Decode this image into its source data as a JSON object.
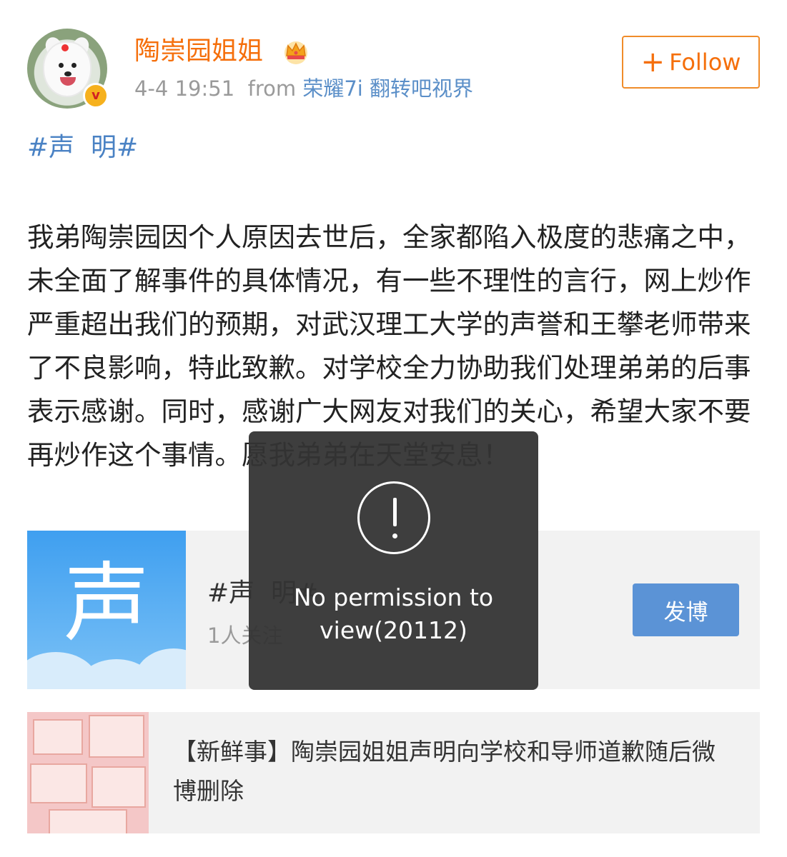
{
  "post": {
    "username": "陶崇园姐姐",
    "verified_badge": "v",
    "time": "4-4 19:51",
    "from_label": "from",
    "source": "荣耀7i 翻转吧视界",
    "follow_label": "Follow",
    "hashtag": "#声  明#",
    "body": "我弟陶崇园因个人原因去世后，全家都陷入极度的悲痛之中，未全面了解事件的具体情况，有一些不理性的言行，网上炒作严重超出我们的预期，对武汉理工大学的声誉和王攀老师带来了不良影响，特此致歉。对学校全力协助我们处理弟弟的后事表示感谢。同时，感谢广大网友对我们的关心，希望大家不要再炒作这个事情。愿我弟弟在天堂安息！"
  },
  "topic_card": {
    "thumb_char": "声",
    "title": "#声  明#",
    "followers": "1人关注",
    "post_button": "发博"
  },
  "news_card": {
    "text": "【新鲜事】陶崇园姐姐声明向学校和导师道歉随后微博删除"
  },
  "toast": {
    "message": "No permission to view(20112)"
  },
  "icons": {
    "avatar": "samoyed-dog-avatar",
    "crown": "crown-icon",
    "alert": "exclamation-circle-icon"
  },
  "colors": {
    "username": "#f56f0b",
    "link": "#4a82c4",
    "button": "#5b93d6",
    "toast_bg": "#343434"
  }
}
